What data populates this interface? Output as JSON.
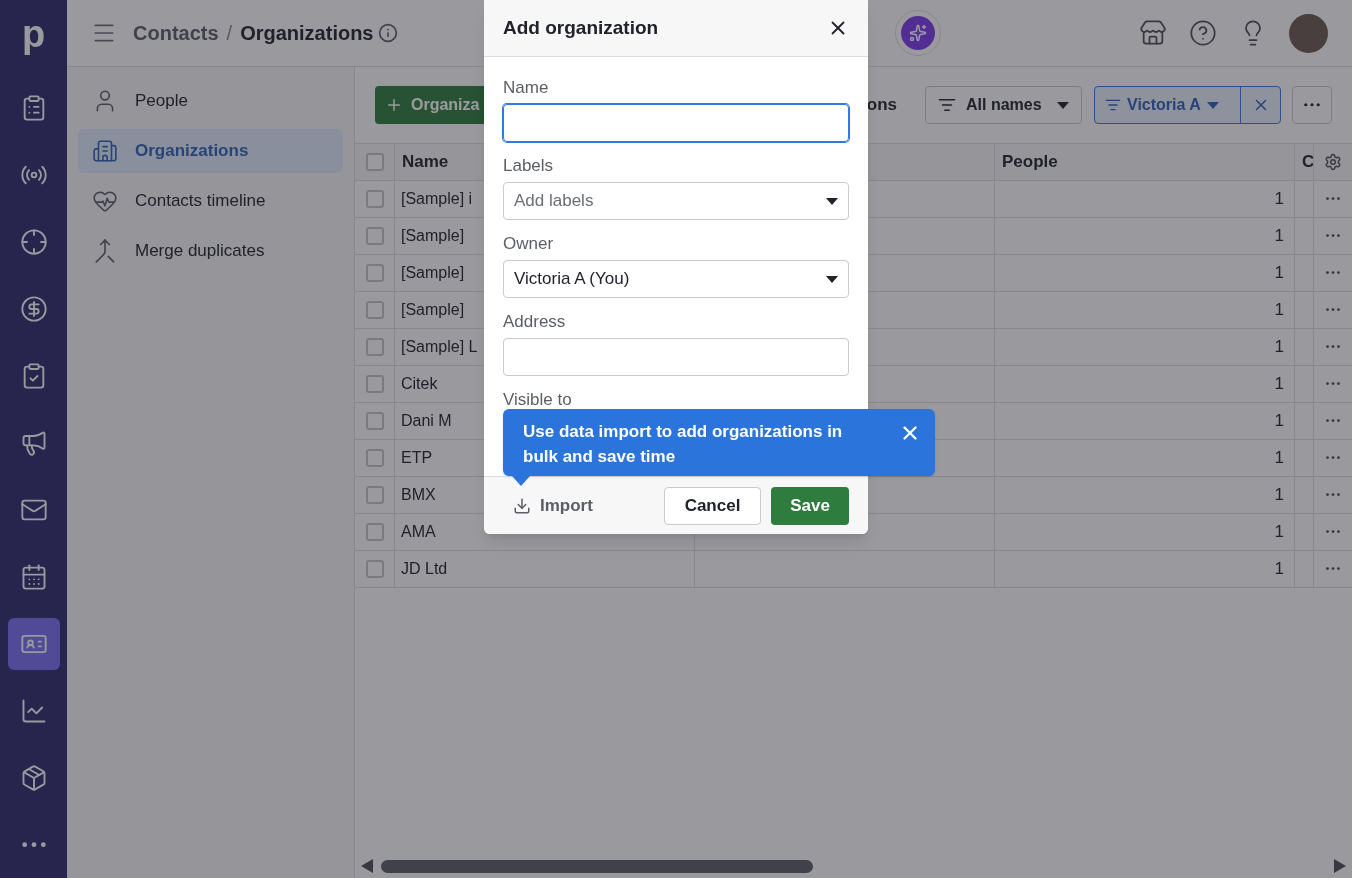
{
  "logo": "p",
  "nav": [
    {
      "kind": "list",
      "selected": false
    },
    {
      "kind": "signal",
      "selected": false
    },
    {
      "kind": "target",
      "selected": false
    },
    {
      "kind": "dollar",
      "selected": false
    },
    {
      "kind": "task",
      "selected": false
    },
    {
      "kind": "megaphone",
      "selected": false
    },
    {
      "kind": "mail",
      "selected": false
    },
    {
      "kind": "calendar",
      "selected": false
    },
    {
      "kind": "contacts",
      "selected": true
    },
    {
      "kind": "chart",
      "selected": false
    },
    {
      "kind": "box",
      "selected": false
    },
    {
      "kind": "more",
      "selected": false
    }
  ],
  "breadcrumb": {
    "parent": "Contacts",
    "separator": "/",
    "current": "Organizations"
  },
  "subnav": [
    {
      "label": "People",
      "kind": "person",
      "selected": false
    },
    {
      "label": "Organizations",
      "kind": "building",
      "selected": true
    },
    {
      "label": "Contacts timeline",
      "kind": "heart",
      "selected": false
    },
    {
      "label": "Merge duplicates",
      "kind": "merge",
      "selected": false
    }
  ],
  "toolbar": {
    "add_button": "Organiza",
    "partial_text": "ons",
    "name_filter": "All names",
    "owner_filter": "Victoria A"
  },
  "table": {
    "columns": [
      "Name",
      "People",
      "C"
    ],
    "header_checked": false,
    "rows": [
      {
        "name": "[Sample] i",
        "people": "1",
        "checked": false
      },
      {
        "name": "[Sample]",
        "people": "1",
        "checked": false
      },
      {
        "name": "[Sample]",
        "people": "1",
        "checked": false
      },
      {
        "name": "[Sample]",
        "people": "1",
        "checked": false
      },
      {
        "name": "[Sample] L",
        "people": "1",
        "checked": false
      },
      {
        "name": "Citek",
        "people": "1",
        "checked": false
      },
      {
        "name": "Dani M",
        "people": "1",
        "checked": false
      },
      {
        "name": "ETP",
        "people": "1",
        "checked": false
      },
      {
        "name": "BMX",
        "people": "1",
        "checked": false
      },
      {
        "name": "AMA",
        "people": "1",
        "checked": false
      },
      {
        "name": "JD Ltd",
        "people": "1",
        "checked": false
      }
    ]
  },
  "modal": {
    "title": "Add organization",
    "fields": [
      {
        "label": "Name",
        "kind": "text",
        "focused": true
      },
      {
        "label": "Labels",
        "kind": "select",
        "placeholder": "Add labels"
      },
      {
        "label": "Owner",
        "kind": "select",
        "value": "Victoria A (You)"
      },
      {
        "label": "Address",
        "kind": "text",
        "focused": false
      },
      {
        "label": "Visible to",
        "kind": "heading"
      }
    ],
    "import": "Import",
    "cancel": "Cancel",
    "save": "Save"
  },
  "tooltip": {
    "text": "Use data import to add organizations in bulk and save time"
  }
}
